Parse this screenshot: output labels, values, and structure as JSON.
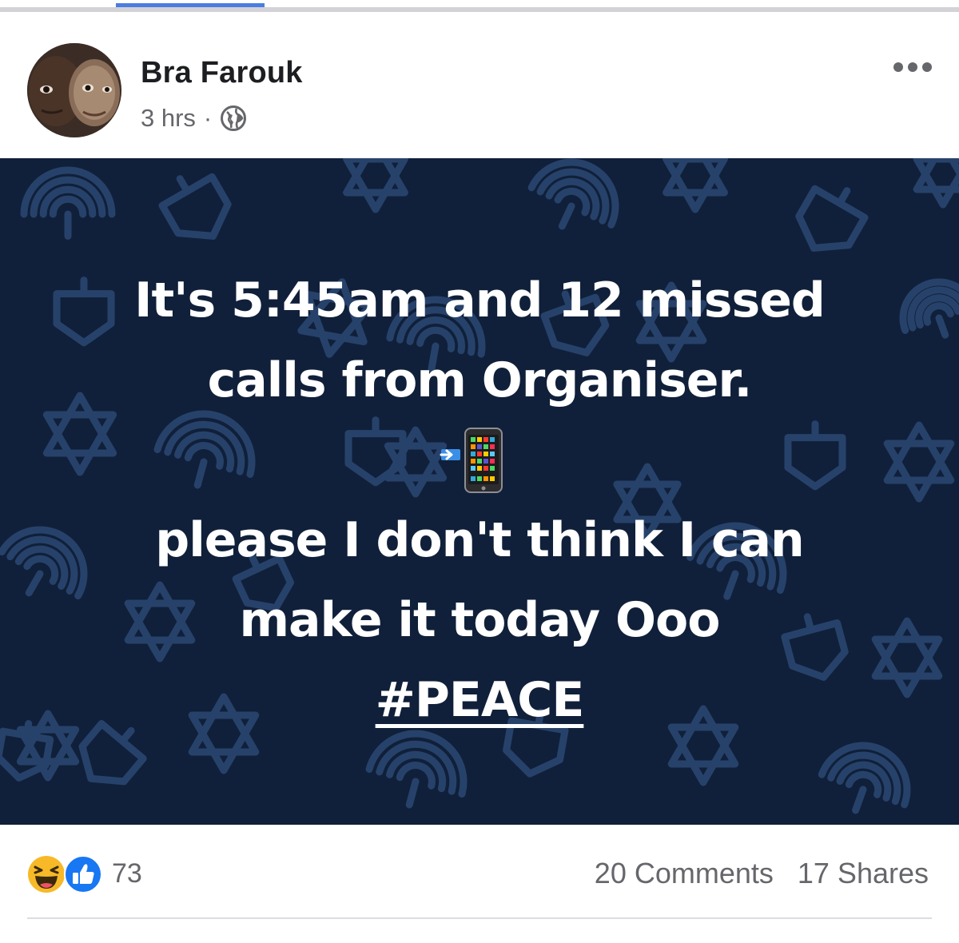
{
  "post": {
    "author": "Bra Farouk",
    "time": "3 hrs",
    "separator": "·",
    "audience_icon": "globe-icon",
    "more_icon": "more-dots-icon"
  },
  "image": {
    "background_color": "#10203a",
    "pattern_color": "#27426a",
    "lines": [
      "It's 5:45am and 12 missed",
      "calls from Organiser.",
      "please I don't think I can",
      "make it today Ooo"
    ],
    "emoji": "📲",
    "hashtag": "#PEACE"
  },
  "footer": {
    "reaction_icons": [
      "haha-icon",
      "like-icon"
    ],
    "reaction_count": "73",
    "comments": "20 Comments",
    "shares": "17 Shares"
  },
  "colors": {
    "like_blue": "#1877f2",
    "haha_yellow": "#f7b928",
    "tab_indicator": "#4a7ee0"
  }
}
